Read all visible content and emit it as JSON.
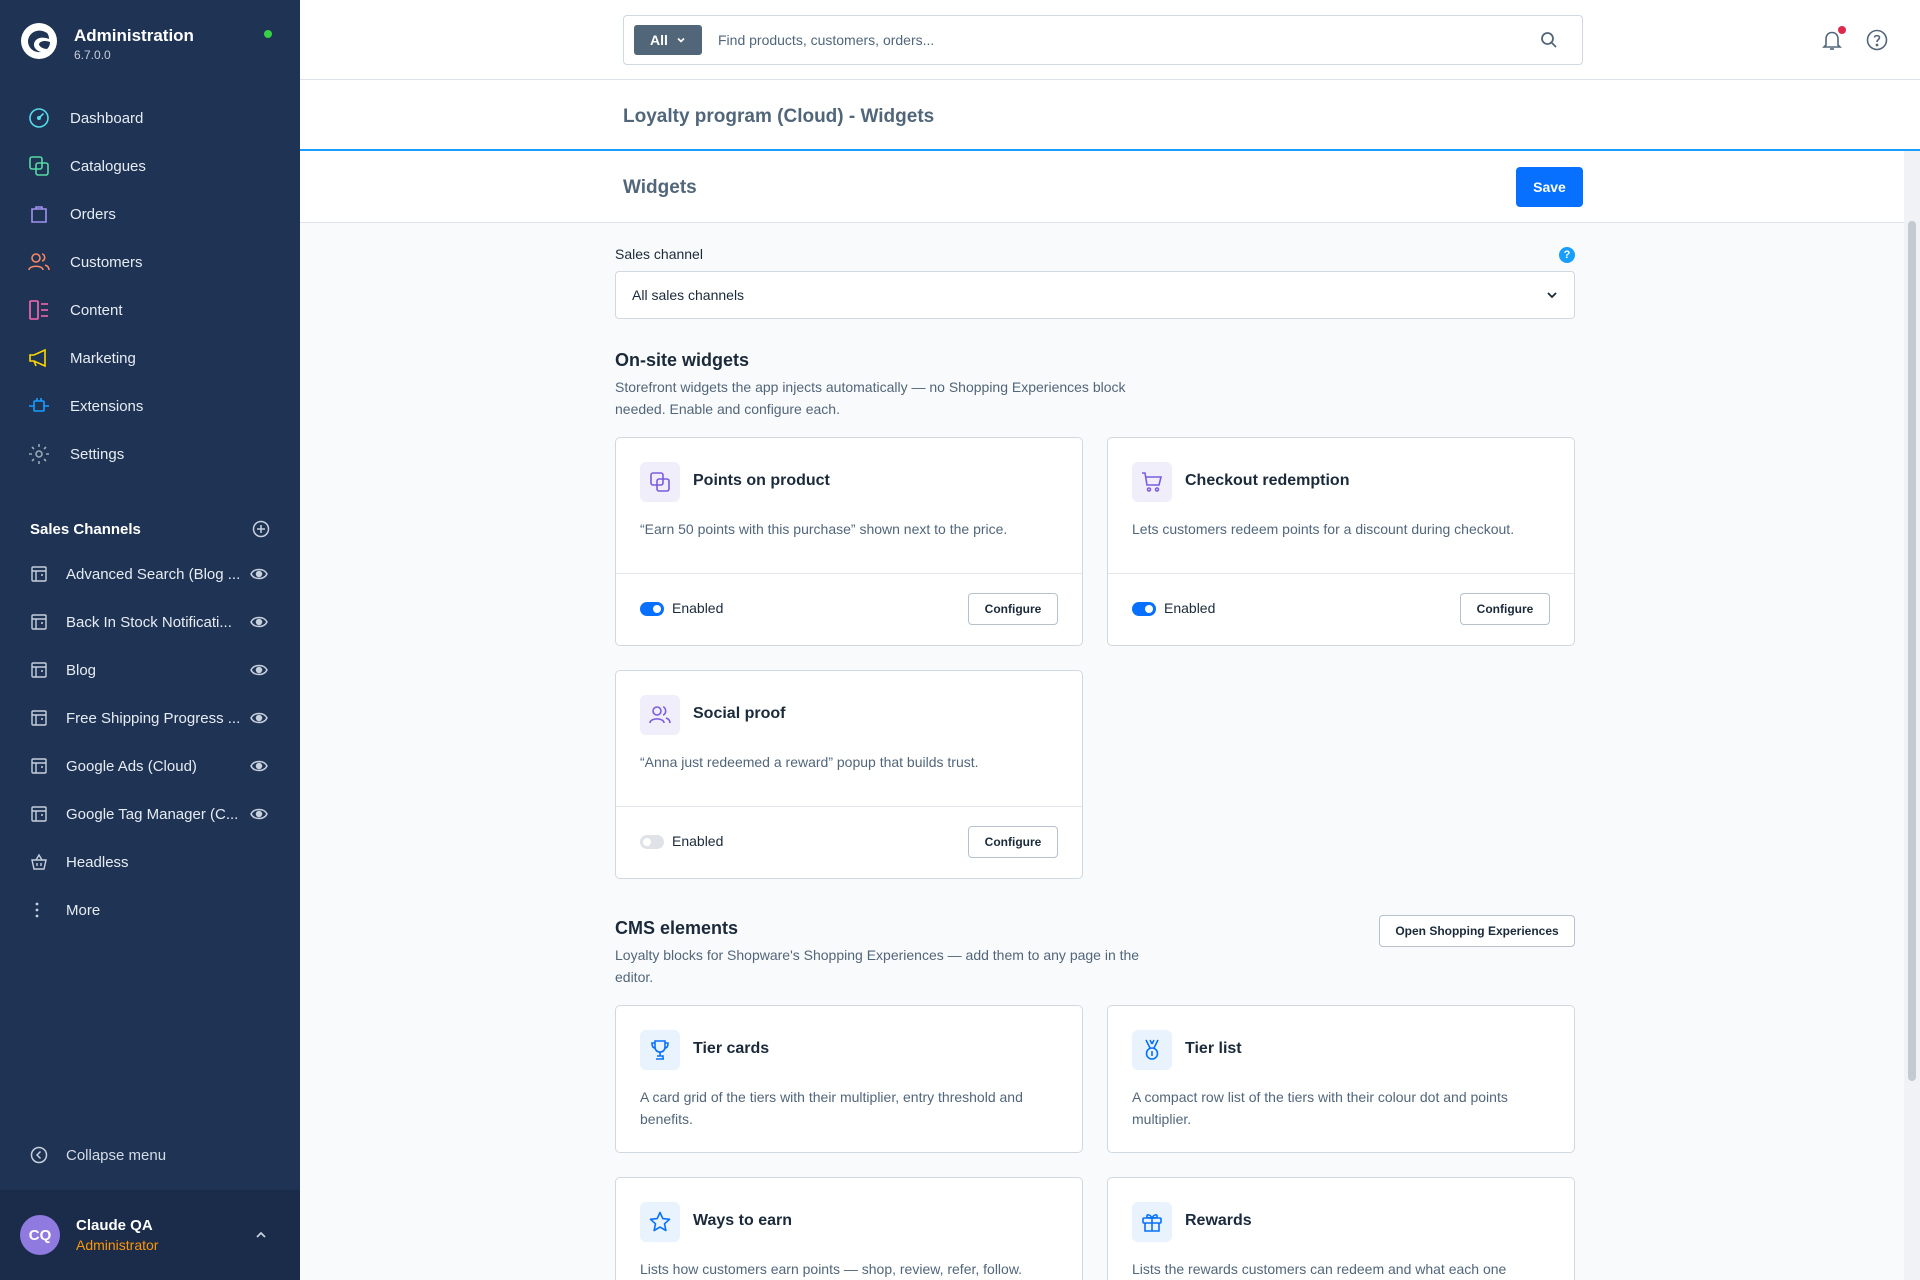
{
  "app": {
    "title": "Administration",
    "version": "6.7.0.0"
  },
  "nav": [
    {
      "label": "Dashboard",
      "icon": "dashboard-icon",
      "color": "#57d9e9"
    },
    {
      "label": "Catalogues",
      "icon": "catalogue-icon",
      "color": "#57d9a3"
    },
    {
      "label": "Orders",
      "icon": "orders-icon",
      "color": "#a092f0"
    },
    {
      "label": "Customers",
      "icon": "customers-icon",
      "color": "#f88962"
    },
    {
      "label": "Content",
      "icon": "content-icon",
      "color": "#ff68b4"
    },
    {
      "label": "Marketing",
      "icon": "marketing-icon",
      "color": "#ffd700"
    },
    {
      "label": "Extensions",
      "icon": "extensions-icon",
      "color": "#189eff"
    },
    {
      "label": "Settings",
      "icon": "settings-icon",
      "color": "#9aa8b5"
    }
  ],
  "sales_channels": {
    "title": "Sales Channels",
    "items": [
      {
        "label": "Advanced Search (Blog ..."
      },
      {
        "label": "Back In Stock Notificati..."
      },
      {
        "label": "Blog"
      },
      {
        "label": "Free Shipping Progress ..."
      },
      {
        "label": "Google Ads (Cloud)"
      },
      {
        "label": "Google Tag Manager (C..."
      },
      {
        "label": "Headless"
      },
      {
        "label": "More"
      }
    ]
  },
  "collapse_label": "Collapse menu",
  "user": {
    "initials": "CQ",
    "name": "Claude QA",
    "role": "Administrator"
  },
  "search": {
    "type": "All",
    "placeholder": "Find products, customers, orders..."
  },
  "page": {
    "title": "Loyalty program (Cloud) - Widgets",
    "subtitle": "Widgets",
    "save_label": "Save"
  },
  "sales_channel_field": {
    "label": "Sales channel",
    "help": "?",
    "value": "All sales channels"
  },
  "onsite": {
    "title": "On-site widgets",
    "description": "Storefront widgets the app injects automatically — no Shopping Experiences block needed. Enable and configure each.",
    "widgets": [
      {
        "title": "Points on product",
        "description": "“Earn 50 points with this purchase” shown next to the price.",
        "enabled": true,
        "toggle_label": "Enabled",
        "configure_label": "Configure"
      },
      {
        "title": "Checkout redemption",
        "description": "Lets customers redeem points for a discount during checkout.",
        "enabled": true,
        "toggle_label": "Enabled",
        "configure_label": "Configure"
      },
      {
        "title": "Social proof",
        "description": "“Anna just redeemed a reward” popup that builds trust.",
        "enabled": false,
        "toggle_label": "Enabled",
        "configure_label": "Configure"
      }
    ]
  },
  "cms": {
    "title": "CMS elements",
    "description": "Loyalty blocks for Shopware's Shopping Experiences — add them to any page in the editor.",
    "open_label": "Open Shopping Experiences",
    "elements": [
      {
        "title": "Tier cards",
        "description": "A card grid of the tiers with their multiplier, entry threshold and benefits."
      },
      {
        "title": "Tier list",
        "description": "A compact row list of the tiers with their colour dot and points multiplier."
      },
      {
        "title": "Ways to earn",
        "description": "Lists how customers earn points — shop, review, refer, follow."
      },
      {
        "title": "Rewards",
        "description": "Lists the rewards customers can redeem and what each one"
      }
    ]
  }
}
